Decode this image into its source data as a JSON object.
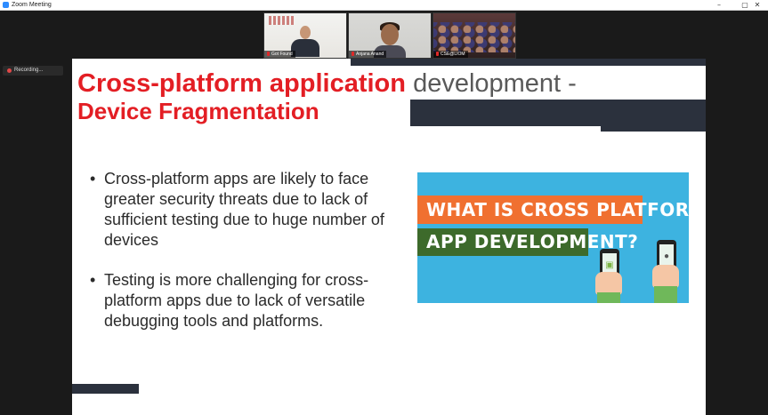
{
  "window": {
    "title": "Zoom Meeting",
    "controls": {
      "minimize": "–",
      "maximize": "▢",
      "close": "✕"
    }
  },
  "participants": [
    {
      "name": "Got Found",
      "muted": true
    },
    {
      "name": "Anjana Anand",
      "muted": true
    },
    {
      "name": "CSE@LIOM",
      "muted": true
    }
  ],
  "recording": {
    "label": "Recording..."
  },
  "slide": {
    "title_red": "Cross-platform application",
    "title_gray": "development -",
    "title_line2": "Device Fragmentation",
    "bullets": [
      "Cross-platform apps are likely to face greater security threats due to lack of sufficient testing due to huge number of devices",
      "Testing is more challenging for cross-platform apps due to lack of versatile debugging tools and platforms."
    ],
    "image": {
      "line1": "WHAT IS CROSS PLATFORM",
      "line2": "APP DEVELOPMENT?",
      "icons": [
        "android-icon",
        "apple-icon"
      ],
      "colors": {
        "background": "#3db3e0",
        "banner1": "#f07030",
        "banner2": "#3d6a2b"
      }
    },
    "colors": {
      "title_red": "#e31e24",
      "title_gray": "#595959",
      "decor": "#2b313d"
    }
  }
}
